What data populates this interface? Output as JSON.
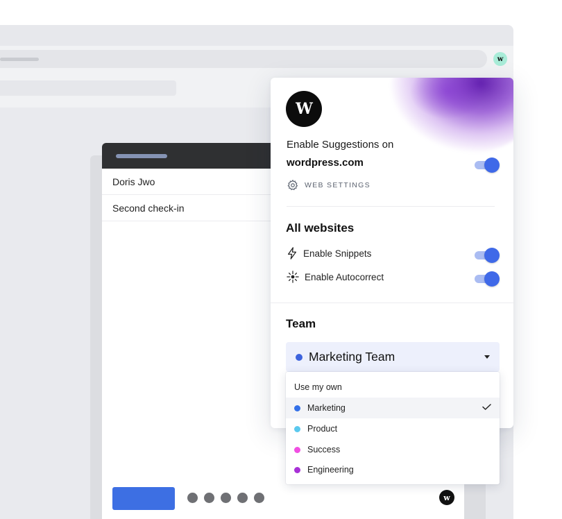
{
  "browser": {
    "extension_icon_letter": "w"
  },
  "compose": {
    "fields": [
      "Doris Jwo",
      "Second check-in"
    ],
    "logo_letter": "w"
  },
  "popup": {
    "logo_letter": "W",
    "enable_text": "Enable Suggestions on",
    "site": "wordpress.com",
    "site_toggle_on": true,
    "web_settings_label": "WEB SETTINGS",
    "all_websites_title": "All websites",
    "options": [
      {
        "label": "Enable Snippets",
        "icon": "lightning-icon",
        "enabled": true
      },
      {
        "label": "Enable Autocorrect",
        "icon": "sparkle-icon",
        "enabled": true
      }
    ],
    "team_title": "Team",
    "team_selected": "Marketing Team",
    "team_selected_color": "#3d63dd"
  },
  "dropdown": {
    "header": "Use my own",
    "items": [
      {
        "label": "Marketing",
        "color": "#3370e8",
        "selected": true
      },
      {
        "label": "Product",
        "color": "#5bc9ee",
        "selected": false
      },
      {
        "label": "Success",
        "color": "#f04fe2",
        "selected": false
      },
      {
        "label": "Engineering",
        "color": "#a830d6",
        "selected": false
      }
    ]
  },
  "colors": {
    "accent": "#3f69e8",
    "send_button": "#3d6fe3",
    "splash": "#6a1fc0"
  }
}
